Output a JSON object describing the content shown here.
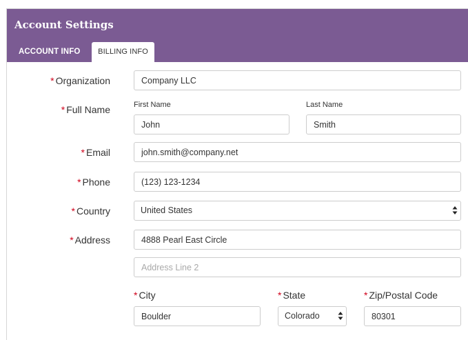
{
  "header": {
    "title": "Account Settings"
  },
  "tabs": [
    {
      "label": "ACCOUNT INFO"
    },
    {
      "label": "BILLING INFO"
    }
  ],
  "required_marker": "*",
  "form": {
    "organization": {
      "label": "Organization",
      "value": "Company LLC"
    },
    "full_name": {
      "label": "Full Name",
      "first_label": "First Name",
      "first_value": "John",
      "last_label": "Last Name",
      "last_value": "Smith"
    },
    "email": {
      "label": "Email",
      "value": "john.smith@company.net"
    },
    "phone": {
      "label": "Phone",
      "value": "(123) 123-1234"
    },
    "country": {
      "label": "Country",
      "value": "United States"
    },
    "address": {
      "label": "Address",
      "value": "4888 Pearl East Circle",
      "line2_placeholder": "Address Line 2"
    },
    "city": {
      "label": "City",
      "value": "Boulder"
    },
    "state": {
      "label": "State",
      "value": "Colorado"
    },
    "zip": {
      "label": "Zip/Postal Code",
      "value": "80301"
    }
  },
  "colors": {
    "header": "#7b5b93",
    "required": "#d0021b"
  },
  "icons": {
    "select_arrow": "sort-arrows-icon"
  }
}
